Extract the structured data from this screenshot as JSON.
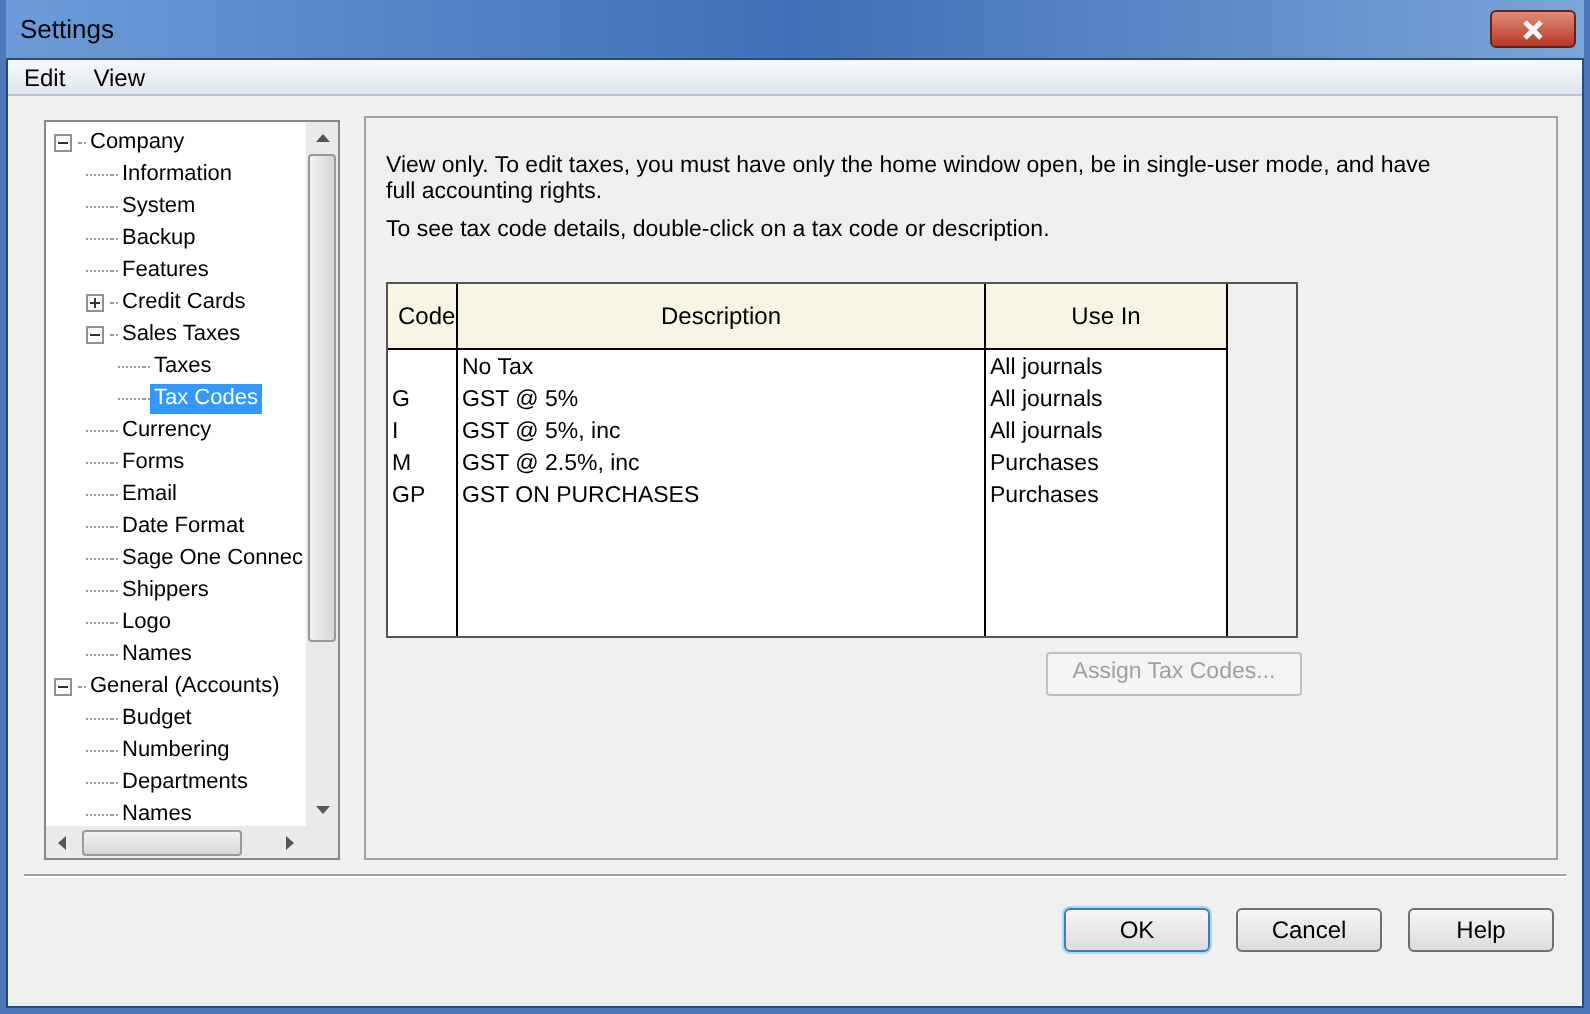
{
  "window": {
    "title": "Settings"
  },
  "menu": [
    "Edit",
    "View"
  ],
  "tree": [
    {
      "label": "Company",
      "expanded": true,
      "selected": false,
      "children": [
        {
          "label": "Information",
          "selected": false
        },
        {
          "label": "System",
          "selected": false
        },
        {
          "label": "Backup",
          "selected": false
        },
        {
          "label": "Features",
          "selected": false
        },
        {
          "label": "Credit Cards",
          "expanded": false,
          "selected": false
        },
        {
          "label": "Sales Taxes",
          "expanded": true,
          "selected": false,
          "children": [
            {
              "label": "Taxes",
              "selected": false
            },
            {
              "label": "Tax Codes",
              "selected": true
            }
          ]
        },
        {
          "label": "Currency",
          "selected": false
        },
        {
          "label": "Forms",
          "selected": false
        },
        {
          "label": "Email",
          "selected": false
        },
        {
          "label": "Date Format",
          "selected": false
        },
        {
          "label": "Sage One Connec",
          "selected": false
        },
        {
          "label": "Shippers",
          "selected": false
        },
        {
          "label": "Logo",
          "selected": false
        },
        {
          "label": "Names",
          "selected": false
        }
      ]
    },
    {
      "label": "General (Accounts)",
      "expanded": true,
      "selected": false,
      "children": [
        {
          "label": "Budget",
          "selected": false
        },
        {
          "label": "Numbering",
          "selected": false
        },
        {
          "label": "Departments",
          "selected": false
        },
        {
          "label": "Names",
          "selected": false
        }
      ]
    }
  ],
  "notes": [
    "View only. To edit taxes, you must have only the home window open, be in single-user mode, and have full accounting rights.",
    "To see tax code details, double-click on a tax code or description."
  ],
  "table": {
    "columns": [
      "Code",
      "Description",
      "Use In"
    ],
    "rows": [
      [
        "",
        "No Tax",
        "All journals"
      ],
      [
        "G",
        "GST @ 5%",
        "All journals"
      ],
      [
        "I",
        "GST @ 5%, inc",
        "All journals"
      ],
      [
        "M",
        "GST @ 2.5%, inc",
        "Purchases"
      ],
      [
        "GP",
        "GST ON PURCHASES",
        "Purchases"
      ]
    ]
  },
  "assign_button": {
    "label": "Assign Tax Codes...",
    "disabled": true
  },
  "buttons": [
    {
      "label": "OK",
      "default": true
    },
    {
      "label": "Cancel",
      "default": false
    },
    {
      "label": "Help",
      "default": false
    }
  ]
}
